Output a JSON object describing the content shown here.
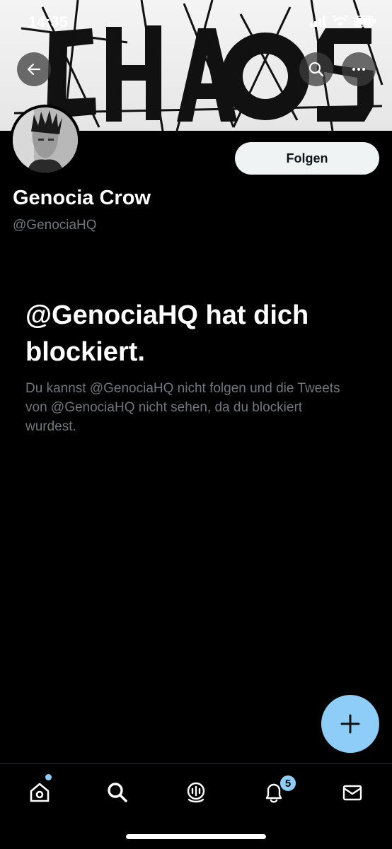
{
  "status_bar": {
    "time": "14:35"
  },
  "banner": {
    "logo_text": "CHAOS"
  },
  "header": {
    "back_icon": "arrow-left-icon",
    "search_icon": "search-icon",
    "more_icon": "more-horizontal-icon"
  },
  "profile": {
    "display_name": "Genocia Crow",
    "handle": "@GenociaHQ",
    "follow_label": "Folgen"
  },
  "blocked": {
    "title": "@GenociaHQ hat dich blockiert.",
    "message": "Du kannst @GenociaHQ nicht folgen und die Tweets von @GenociaHQ nicht sehen, da du blockiert wurdest."
  },
  "fab": {
    "icon": "plus-icon"
  },
  "tab_bar": {
    "items": [
      {
        "name": "home",
        "icon": "home-icon",
        "has_dot": true
      },
      {
        "name": "search",
        "icon": "search-icon"
      },
      {
        "name": "spaces",
        "icon": "spaces-mic-icon"
      },
      {
        "name": "notifications",
        "icon": "bell-icon",
        "badge": "5"
      },
      {
        "name": "messages",
        "icon": "mail-icon"
      }
    ]
  },
  "colors": {
    "accent": "#8ecdf7",
    "muted_text": "#71767b",
    "follow_bg": "#eff3f4"
  }
}
